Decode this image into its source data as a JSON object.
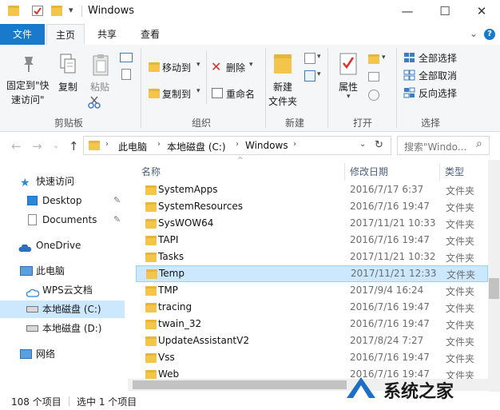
{
  "window": {
    "title": "Windows",
    "qat_dropdown": "▾",
    "buttons": {
      "minimize": "—",
      "maximize": "☐",
      "close": "✕"
    }
  },
  "ribbon_tabs": {
    "file": "文件",
    "home": "主页",
    "share": "共享",
    "view": "查看"
  },
  "ribbon_controls": {
    "collapse": "⌄",
    "help": "?"
  },
  "ribbon": {
    "clipboard": {
      "group": "剪贴板",
      "pin_line1": "固定到\"快",
      "pin_line2": "速访问\"",
      "copy": "复制",
      "paste": "粘贴"
    },
    "organize": {
      "group": "组织",
      "move_to": "移动到",
      "copy_to": "复制到",
      "delete": "删除",
      "rename": "重命名"
    },
    "new": {
      "group": "新建",
      "new_folder_line1": "新建",
      "new_folder_line2": "文件夹"
    },
    "open": {
      "group": "打开",
      "properties": "属性"
    },
    "select": {
      "group": "选择",
      "select_all": "全部选择",
      "select_none": "全部取消",
      "invert": "反向选择"
    }
  },
  "address": {
    "crumbs": [
      "此电脑",
      "本地磁盘 (C:)",
      "Windows"
    ],
    "search_placeholder": "搜索\"Windo...",
    "search_icon": "⌕"
  },
  "nav_pane": {
    "quick_access": "快速访问",
    "desktop": "Desktop",
    "documents": "Documents",
    "onedrive": "OneDrive",
    "this_pc": "此电脑",
    "wps": "WPS云文档",
    "drive_c": "本地磁盘 (C:)",
    "drive_d": "本地磁盘 (D:)",
    "network": "网络"
  },
  "columns": {
    "name": "名称",
    "modified": "修改日期",
    "type": "类型"
  },
  "files": [
    {
      "name": "SystemApps",
      "date": "2016/7/17 6:37",
      "type": "文件夹"
    },
    {
      "name": "SystemResources",
      "date": "2016/7/16 19:47",
      "type": "文件夹"
    },
    {
      "name": "SysWOW64",
      "date": "2017/11/21 10:33",
      "type": "文件夹"
    },
    {
      "name": "TAPI",
      "date": "2016/7/16 19:47",
      "type": "文件夹"
    },
    {
      "name": "Tasks",
      "date": "2017/11/21 10:32",
      "type": "文件夹"
    },
    {
      "name": "Temp",
      "date": "2017/11/21 12:33",
      "type": "文件夹"
    },
    {
      "name": "TMP",
      "date": "2017/9/4 16:24",
      "type": "文件夹"
    },
    {
      "name": "tracing",
      "date": "2016/7/16 19:47",
      "type": "文件夹"
    },
    {
      "name": "twain_32",
      "date": "2016/7/16 19:47",
      "type": "文件夹"
    },
    {
      "name": "UpdateAssistantV2",
      "date": "2017/8/24 7:27",
      "type": "文件夹"
    },
    {
      "name": "Vss",
      "date": "2016/7/16 19:47",
      "type": "文件夹"
    },
    {
      "name": "Web",
      "date": "2016/7/16 19:47",
      "type": "文件夹"
    }
  ],
  "status": {
    "count": "108 个项目",
    "selected": "选中 1 个项目"
  },
  "watermark": {
    "text": "系统之家"
  },
  "colors": {
    "accent": "#1979ca",
    "selection": "#cce8ff",
    "folder": "#f3c54a"
  }
}
